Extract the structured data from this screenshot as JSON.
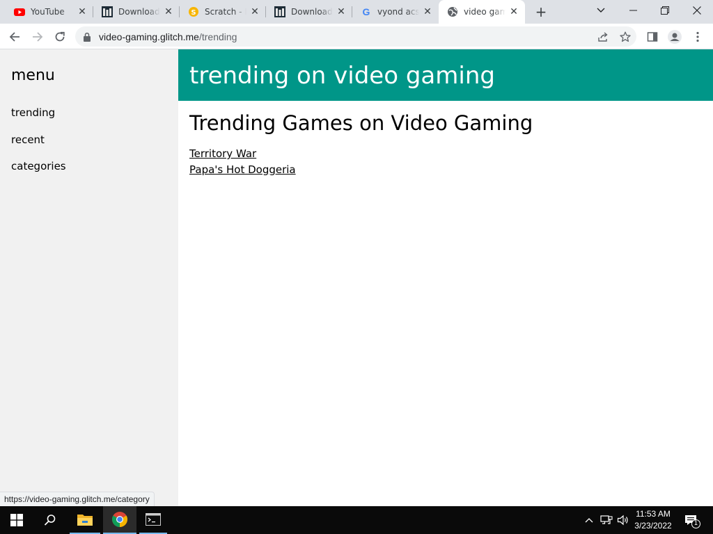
{
  "browser": {
    "tabs": [
      {
        "title": "YouTube",
        "icon": "youtube-icon"
      },
      {
        "title": "Download Wi",
        "icon": "download-site-icon"
      },
      {
        "title": "Scratch - Im",
        "icon": "scratch-icon"
      },
      {
        "title": "Download Wi",
        "icon": "download-site-icon"
      },
      {
        "title": "vyond acs u",
        "icon": "google-icon"
      },
      {
        "title": "video gaming",
        "icon": "globe-icon"
      }
    ],
    "address": {
      "host": "video-gaming.glitch.me",
      "path": "/trending"
    },
    "status_url": "https://video-gaming.glitch.me/category"
  },
  "page": {
    "menu_title": "menu",
    "menu_items": [
      "trending",
      "recent",
      "categories"
    ],
    "header_title": "trending on video gaming",
    "main_title": "Trending Games on Video Gaming",
    "games": [
      "Territory War",
      "Papa's Hot Doggeria"
    ]
  },
  "taskbar": {
    "time": "11:53 AM",
    "date": "3/23/2022",
    "notification_count": "1"
  },
  "colors": {
    "header": "#009688",
    "sidebar": "#f1f1f1",
    "tabstrip": "#dee1e6"
  }
}
